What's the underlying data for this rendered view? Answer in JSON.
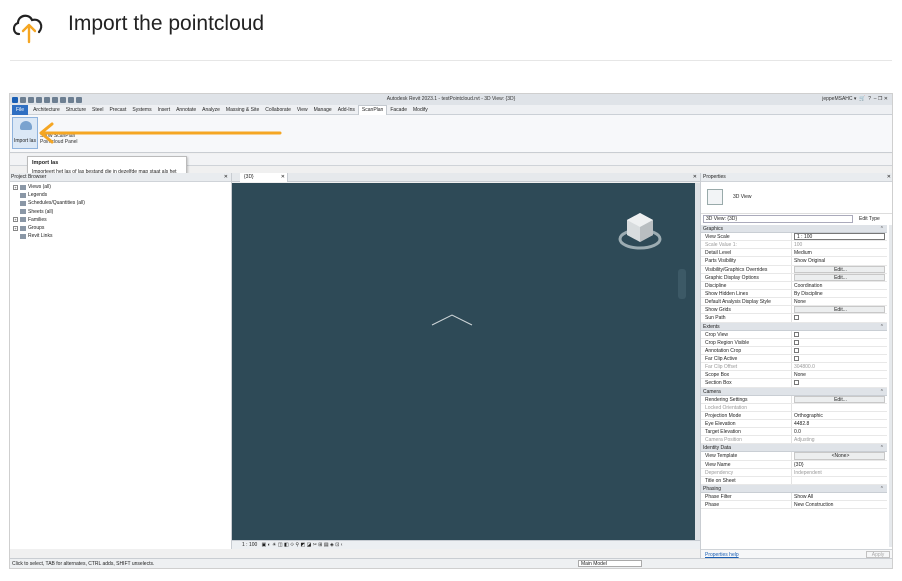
{
  "page": {
    "title": "Import the pointcloud",
    "icon": "cloud-upload-icon",
    "accent_color": "#f5a623"
  },
  "revit": {
    "window_title": "Autodesk Revit 2023.1 - testPointcloud.rvt - 3D View: {3D}",
    "user": "jeppeMSAHC",
    "tabs": [
      "File",
      "Architecture",
      "Structure",
      "Steel",
      "Precast",
      "Systems",
      "Insert",
      "Annotate",
      "Analyze",
      "Massing & Site",
      "Collaborate",
      "View",
      "Manage",
      "Add-Ins",
      "ScanPlan",
      "Facade",
      "Modify"
    ],
    "active_tab": "ScanPlan",
    "ribbon": {
      "import_button": "Import las",
      "panel_label_1": "Show ScanPlan",
      "panel_label_2": "Pointcloud Panel"
    },
    "tooltip": {
      "title": "Import las",
      "text": "Importeert het las of las bestand die in dezelfde map staat als het Revit bestand."
    },
    "project_browser": {
      "header": "Project Browser",
      "items": [
        "Views (all)",
        "Legends",
        "Schedules/Quantities (all)",
        "Sheets (all)",
        "Families",
        "Groups",
        "Revit Links"
      ]
    },
    "view": {
      "tab_label": "{3D}",
      "scale": "1 : 100"
    },
    "properties": {
      "header": "Properties",
      "type_name": "3D View",
      "selector": "3D View: {3D}",
      "edit_type": "Edit Type",
      "groups": [
        {
          "name": "Graphics",
          "rows": [
            {
              "k": "View Scale",
              "v": "1 : 100",
              "kind": "input"
            },
            {
              "k": "Scale Value    1:",
              "v": "100",
              "kind": "dis"
            },
            {
              "k": "Detail Level",
              "v": "Medium"
            },
            {
              "k": "Parts Visibility",
              "v": "Show Original"
            },
            {
              "k": "Visibility/Graphics Overrides",
              "v": "Edit...",
              "kind": "btn"
            },
            {
              "k": "Graphic Display Options",
              "v": "Edit...",
              "kind": "btn"
            },
            {
              "k": "Discipline",
              "v": "Coordination"
            },
            {
              "k": "Show Hidden Lines",
              "v": "By Discipline"
            },
            {
              "k": "Default Analysis Display Style",
              "v": "None"
            },
            {
              "k": "Show Grids",
              "v": "Edit...",
              "kind": "btn"
            },
            {
              "k": "Sun Path",
              "v": "",
              "kind": "chk"
            }
          ]
        },
        {
          "name": "Extents",
          "rows": [
            {
              "k": "Crop View",
              "v": "",
              "kind": "chk"
            },
            {
              "k": "Crop Region Visible",
              "v": "",
              "kind": "chk"
            },
            {
              "k": "Annotation Crop",
              "v": "",
              "kind": "chk"
            },
            {
              "k": "Far Clip Active",
              "v": "",
              "kind": "chk"
            },
            {
              "k": "Far Clip Offset",
              "v": "304800.0",
              "kind": "dis"
            },
            {
              "k": "Scope Box",
              "v": "None"
            },
            {
              "k": "Section Box",
              "v": "",
              "kind": "chk"
            }
          ]
        },
        {
          "name": "Camera",
          "rows": [
            {
              "k": "Rendering Settings",
              "v": "Edit...",
              "kind": "btn"
            },
            {
              "k": "Locked Orientation",
              "v": "",
              "kind": "dis"
            },
            {
              "k": "Projection Mode",
              "v": "Orthographic"
            },
            {
              "k": "Eye Elevation",
              "v": "4482.8"
            },
            {
              "k": "Target Elevation",
              "v": "0.0"
            },
            {
              "k": "Camera Position",
              "v": "Adjusting",
              "kind": "dis"
            }
          ]
        },
        {
          "name": "Identity Data",
          "rows": [
            {
              "k": "View Template",
              "v": "<None>",
              "kind": "btn"
            },
            {
              "k": "View Name",
              "v": "{3D}"
            },
            {
              "k": "Dependency",
              "v": "Independent",
              "kind": "dis"
            },
            {
              "k": "Title on Sheet",
              "v": ""
            }
          ]
        },
        {
          "name": "Phasing",
          "rows": [
            {
              "k": "Phase Filter",
              "v": "Show All"
            },
            {
              "k": "Phase",
              "v": "New Construction"
            }
          ]
        }
      ],
      "help_link": "Properties help",
      "apply": "Apply"
    },
    "status_bar": "Click to select, TAB for alternates, CTRL adds, SHIFT unselects.",
    "model": "Main Model",
    "colors": {
      "canvas": "#2e4a57",
      "file_tab": "#2f6fc2",
      "arrow": "#f5a623"
    }
  }
}
